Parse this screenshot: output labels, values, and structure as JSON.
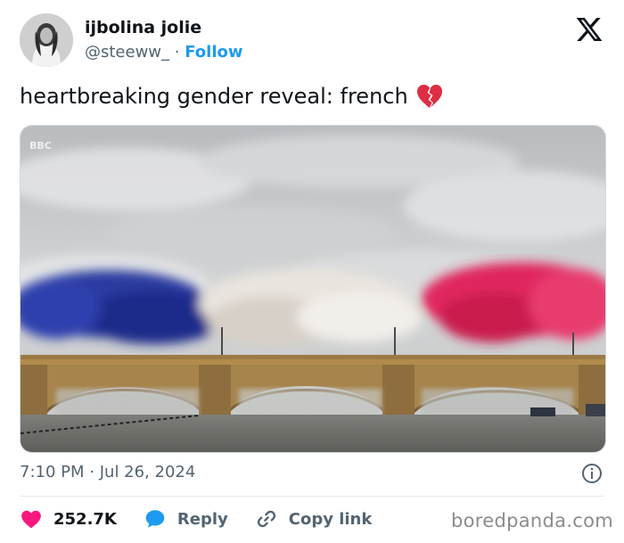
{
  "author": {
    "display_name": "ijbolina jolie",
    "handle": "@steeww_",
    "separator": "·",
    "follow_label": "Follow"
  },
  "tweet": {
    "text": "heartbreaking gender reveal: french",
    "emoji_icon": "broken-heart-icon",
    "media_watermark": "BBC"
  },
  "meta": {
    "time": "7:10 PM",
    "separator": "·",
    "date": "Jul 26, 2024"
  },
  "actions": {
    "like_count": "252.7K",
    "reply_label": "Reply",
    "copy_link_label": "Copy link"
  },
  "watermark": "boredpanda.com",
  "colors": {
    "follow": "#1d9bf0",
    "like": "#f91880",
    "reply": "#1d9bf0",
    "muted": "#536471"
  }
}
